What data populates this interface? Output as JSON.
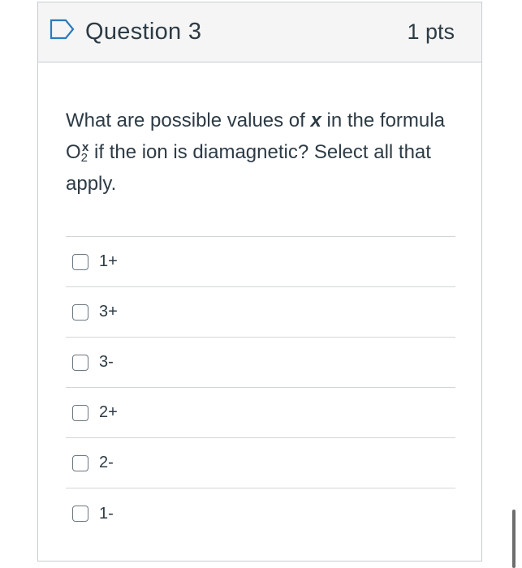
{
  "question": {
    "title": "Question 3",
    "points": "1 pts",
    "flag_icon": "flag-outline-icon",
    "text_before_x": "What are possible values of ",
    "variable": "x",
    "text_after_x": " in the formula O",
    "subscript": "2",
    "superscript": "x",
    "text_end": " if the ion is diamagnetic? Select all that apply."
  },
  "answers": [
    {
      "label": "1+",
      "checked": false
    },
    {
      "label": "3+",
      "checked": false
    },
    {
      "label": "3-",
      "checked": false
    },
    {
      "label": "2+",
      "checked": false
    },
    {
      "label": "2-",
      "checked": false
    },
    {
      "label": "1-",
      "checked": false
    }
  ],
  "colors": {
    "accent": "#2b7abc",
    "text": "#2d3b45",
    "header_bg": "#f5f5f5",
    "border": "#c7cdd1"
  }
}
